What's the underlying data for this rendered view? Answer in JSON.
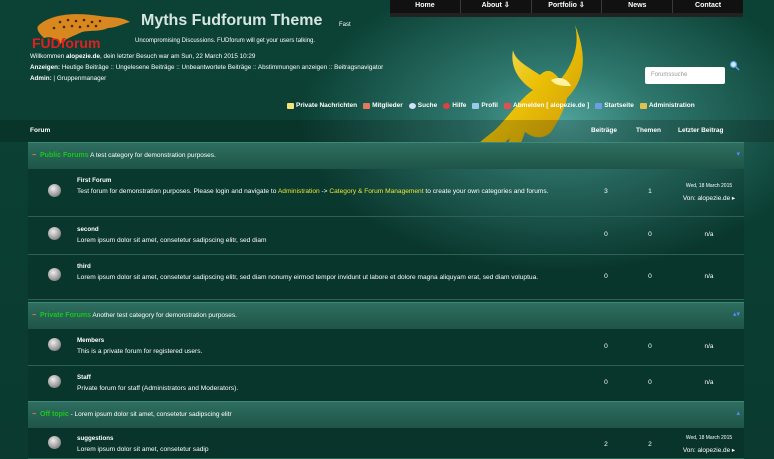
{
  "nav": [
    "Home",
    "About ⇩",
    "Portfolio ⇩",
    "News",
    "Contact"
  ],
  "logo_text": "FUDforum",
  "site_title": "Myths Fudforum Theme",
  "fast": "Fast",
  "tagline": "Uncompromising Discussions. FUDforum will get your users talking.",
  "welcome": {
    "pre": "Willkommen ",
    "user": "alopezie.de",
    "post": ", dein letzter Besuch war am Sun, 22 March 2015 10:29"
  },
  "shows": {
    "label": "Anzeigen:",
    "items": "Heutige Beiträge :: Ungelesene Beiträge :: Unbeantwortete Beiträge :: Abstimmungen anzeigen :: Beitragsnavigator"
  },
  "admin": {
    "label": "Admin:",
    "items": " | Gruppenmanager"
  },
  "search_placeholder": "Forumssuche",
  "usermenu": [
    "Private Nachrichten",
    "Mitglieder",
    "Suche",
    "Hilfe",
    "Profil",
    "Abmelden [ alopezie.de ]",
    "Startseite",
    "Administration"
  ],
  "headers": {
    "forum": "Forum",
    "posts": "Beiträge",
    "topics": "Themen",
    "last": "Letzter Beitrag"
  },
  "categories": [
    {
      "title": "Public Forums",
      "desc": " A test category for demonstration purposes.",
      "caret": "▾"
    },
    {
      "title": "Private Forums",
      "desc": " Another test category for demonstration purposes.",
      "caret": "▴▾"
    },
    {
      "title": "Off topic",
      "desc": " - Lorem ipsum dolor sit amet, consetetur sadipscing elitr",
      "caret": "▴"
    }
  ],
  "forums": [
    {
      "name": "First Forum",
      "desc_a": "Test forum for demonstration purposes. Please login and navigate to ",
      "link1": "Administration",
      "mid": " -> ",
      "link2": "Category & Forum Management",
      "desc_b": " to create your own categories and forums.",
      "posts": "3",
      "topics": "1",
      "date": "Wed, 18 March 2015",
      "by": "Von: alopezie.de ▸"
    },
    {
      "name": "second",
      "desc": "Lorem ipsum dolor sit amet, consetetur sadipscing elitr, sed diam",
      "posts": "0",
      "topics": "0",
      "last": "n/a"
    },
    {
      "name": "third",
      "desc": "Lorem ipsum dolor sit amet, consetetur sadipscing elitr, sed diam nonumy eirmod tempor invidunt ut labore et dolore magna aliquyam erat, sed diam voluptua.",
      "posts": "0",
      "topics": "0",
      "last": "n/a"
    },
    {
      "name": "Members",
      "desc": "This is a private forum for registered users.",
      "posts": "0",
      "topics": "0",
      "last": "n/a"
    },
    {
      "name": "Staff",
      "desc": "Private forum for staff (Administrators and Moderators).",
      "posts": "0",
      "topics": "0",
      "last": "n/a"
    },
    {
      "name": "suggestions",
      "desc": "Lorem ipsum dolor sit amet, consetetur sadip",
      "posts": "2",
      "topics": "2",
      "date": "Wed, 18 March 2015",
      "by": "Von: alopezie.de ▸"
    }
  ]
}
